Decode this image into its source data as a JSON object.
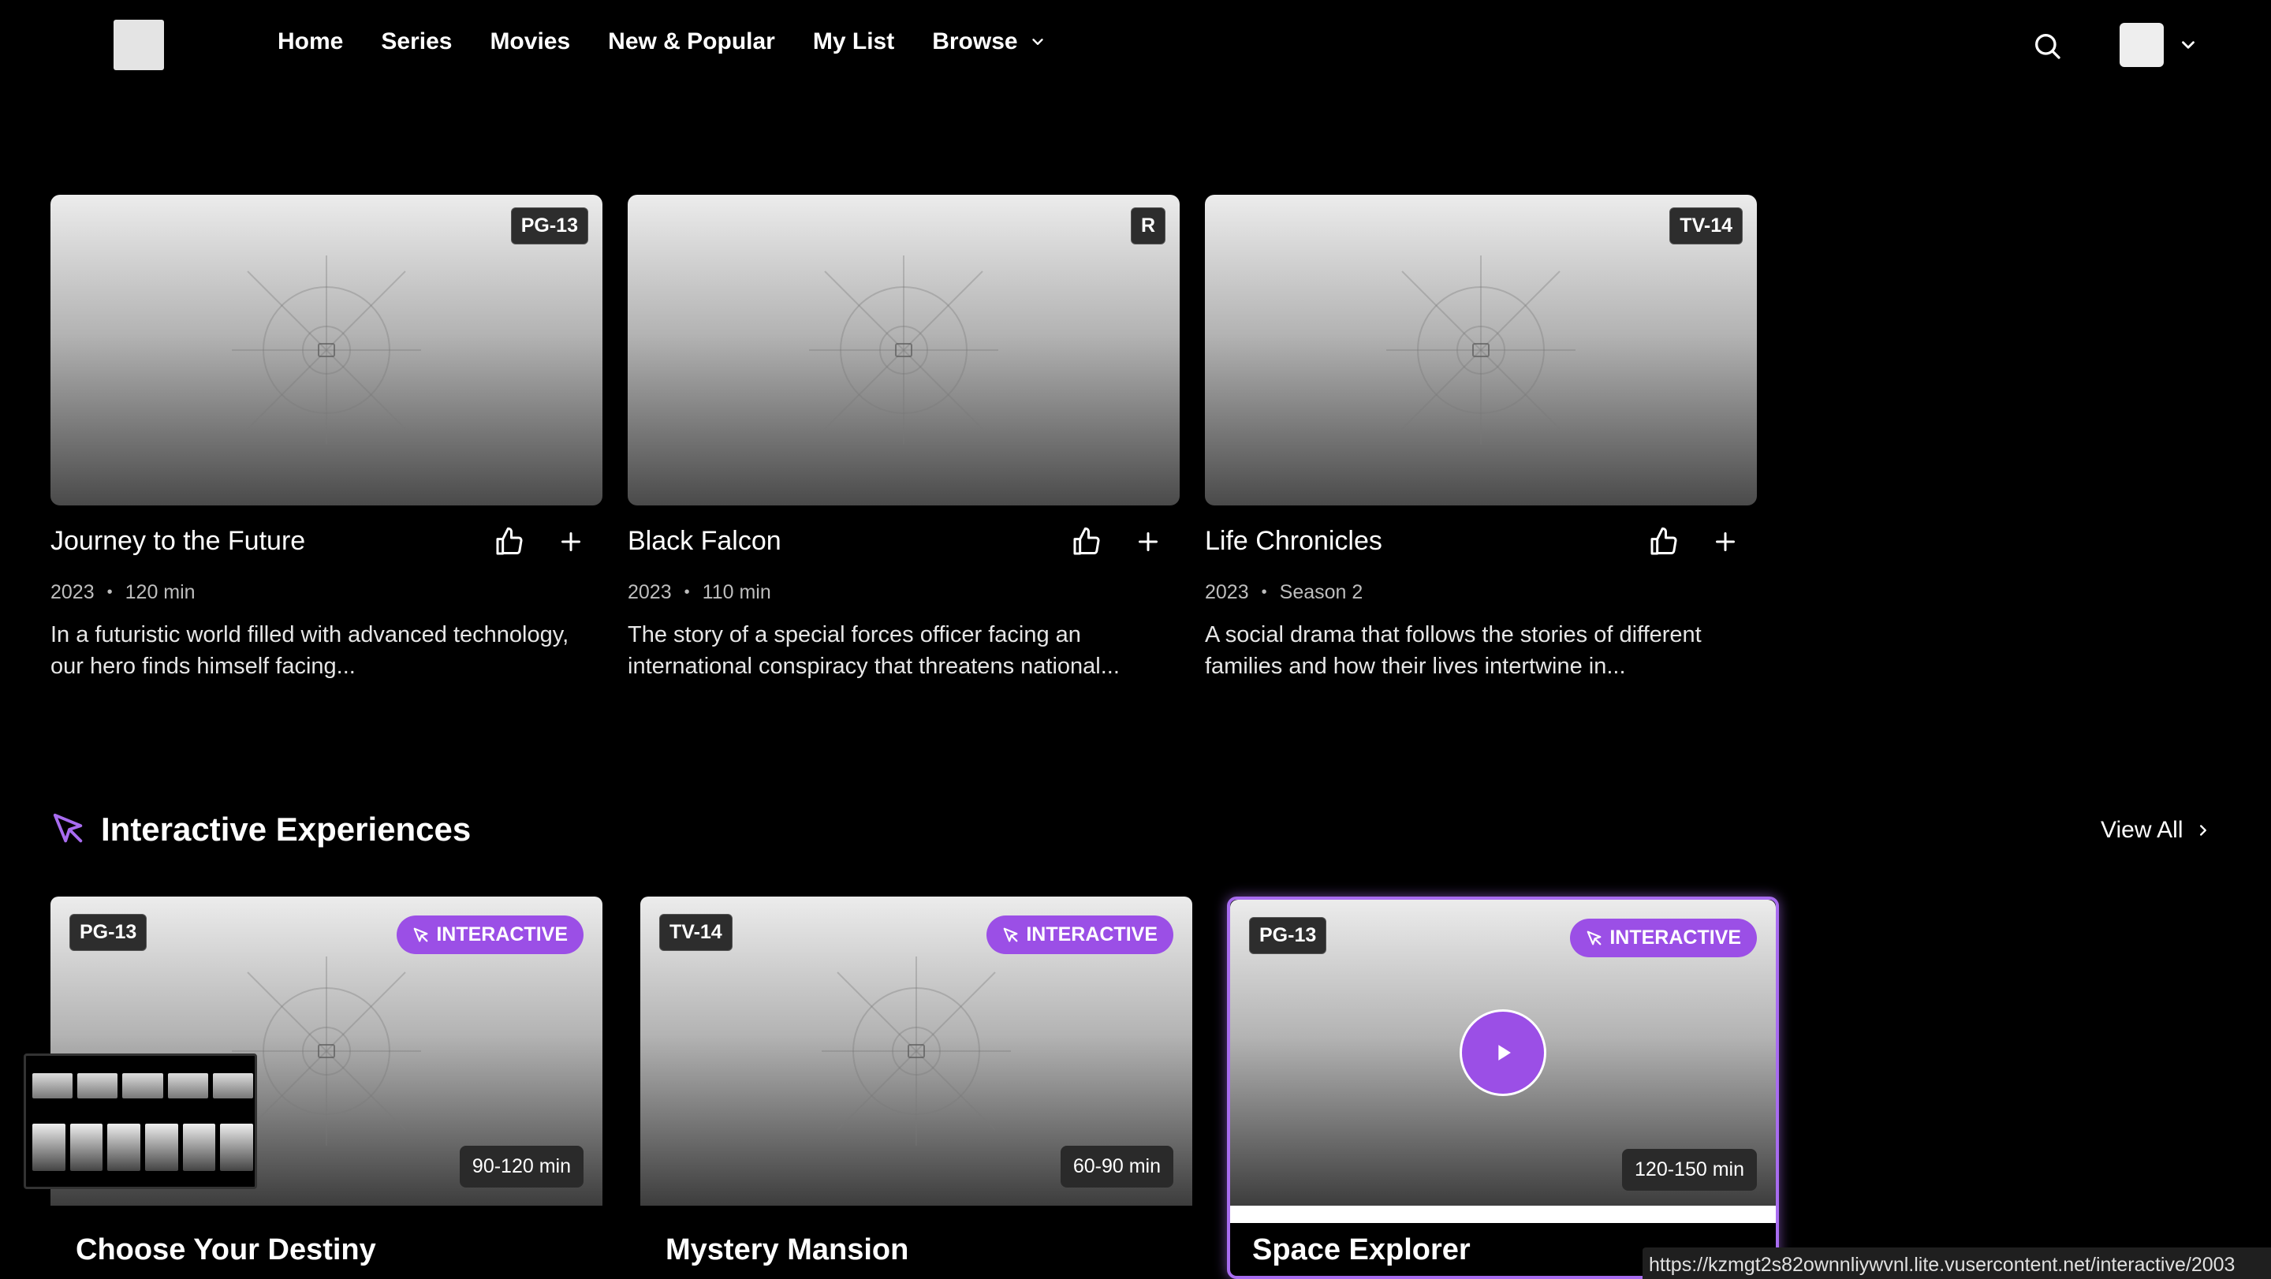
{
  "nav": {
    "items": [
      "Home",
      "Series",
      "Movies",
      "New & Popular",
      "My List",
      "Browse"
    ]
  },
  "cards": [
    {
      "title": "Journey to the Future",
      "rating": "PG-13",
      "year": "2023",
      "duration": "120 min",
      "description": "In a futuristic world filled with advanced technology, our hero finds himself facing..."
    },
    {
      "title": "Black Falcon",
      "rating": "R",
      "year": "2023",
      "duration": "110 min",
      "description": "The story of a special forces officer facing an international conspiracy that threatens national..."
    },
    {
      "title": "Life Chronicles",
      "rating": "TV-14",
      "year": "2023",
      "duration": "Season 2",
      "description": "A social drama that follows the stories of different families and how their lives intertwine in..."
    }
  ],
  "interactive": {
    "title": "Interactive Experiences",
    "view_all": "View All",
    "badge": "INTERACTIVE",
    "items": [
      {
        "title": "Choose Your Destiny",
        "rating": "PG-13",
        "duration": "90-120 min"
      },
      {
        "title": "Mystery Mansion",
        "rating": "TV-14",
        "duration": "60-90 min"
      },
      {
        "title": "Space Explorer",
        "rating": "PG-13",
        "duration": "120-150 min"
      }
    ]
  },
  "status_url": "https://kzmgt2s82ownnliywvnl.lite.vusercontent.net/interactive/2003",
  "colors": {
    "accent": "#9b4fe6",
    "background": "#000000"
  }
}
